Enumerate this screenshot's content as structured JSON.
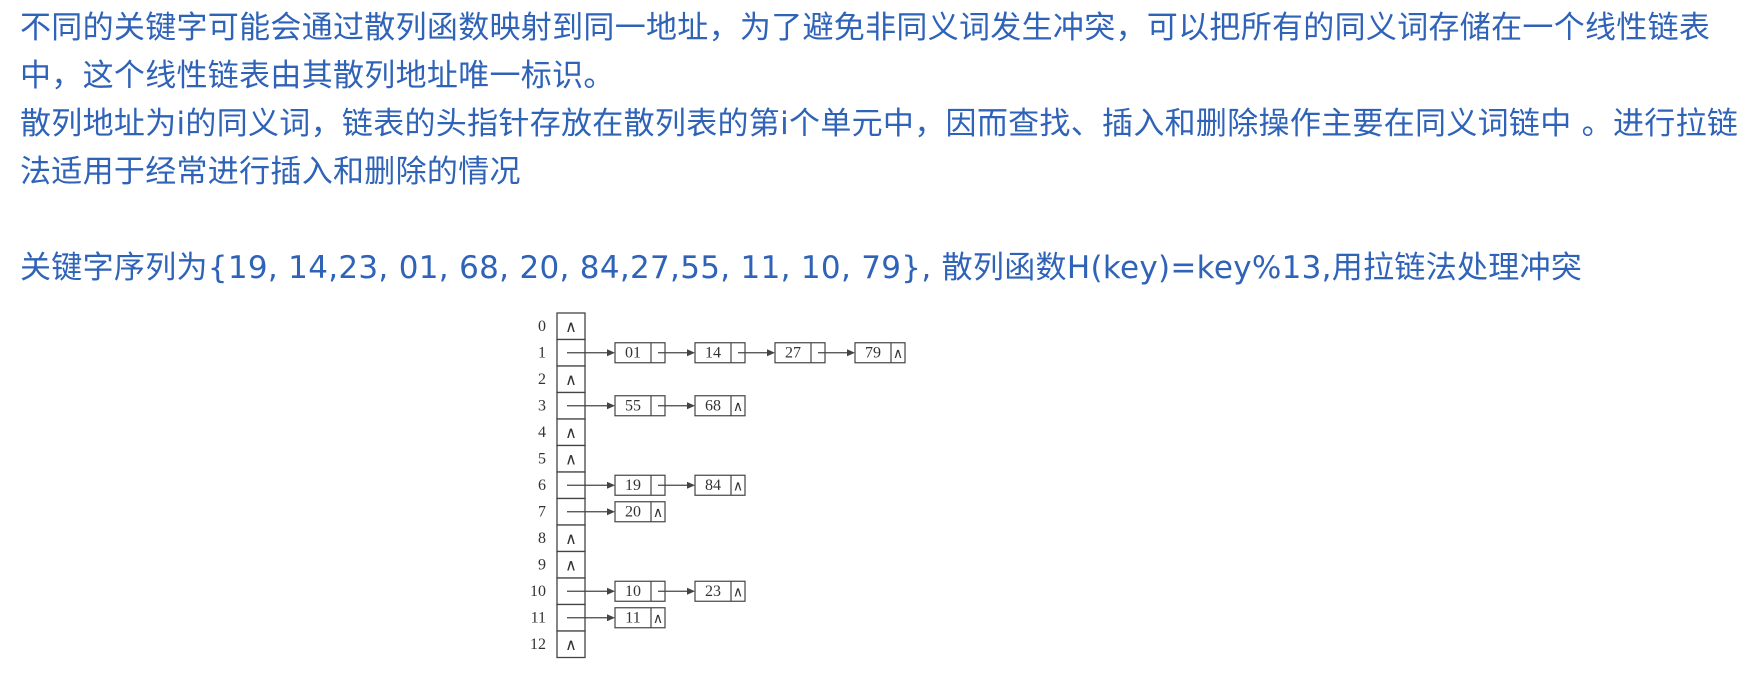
{
  "paragraphs": [
    "不同的关键字可能会通过散列函数映射到同一地址，为了避免非同义词发生冲突，可以把所有的同义词存储在一个线性链表中，这个线性链表由其散列地址唯一标识。",
    "散列地址为i的同义词，链表的头指针存放在散列表的第i个单元中，因而查找、插入和删除操作主要在同义词链中 。进行拉链法适用于经常进行插入和删除的情况",
    "关键字序列为{19, 14,23, 01, 68, 20, 84,27,55, 11, 10, 79}, 散列函数H(key)=key%13,用拉链法处理冲突"
  ],
  "hash_table": {
    "null_symbol": "∧",
    "rows": [
      {
        "index": "0",
        "chain": []
      },
      {
        "index": "1",
        "chain": [
          "01",
          "14",
          "27",
          "79"
        ]
      },
      {
        "index": "2",
        "chain": []
      },
      {
        "index": "3",
        "chain": [
          "55",
          "68"
        ]
      },
      {
        "index": "4",
        "chain": []
      },
      {
        "index": "5",
        "chain": []
      },
      {
        "index": "6",
        "chain": [
          "19",
          "84"
        ]
      },
      {
        "index": "7",
        "chain": [
          "20"
        ]
      },
      {
        "index": "8",
        "chain": []
      },
      {
        "index": "9",
        "chain": []
      },
      {
        "index": "10",
        "chain": [
          "10",
          "23"
        ]
      },
      {
        "index": "11",
        "chain": [
          "11"
        ]
      },
      {
        "index": "12",
        "chain": []
      }
    ]
  },
  "colors": {
    "text": "#2f63b8",
    "diagram_line": "#444444"
  }
}
